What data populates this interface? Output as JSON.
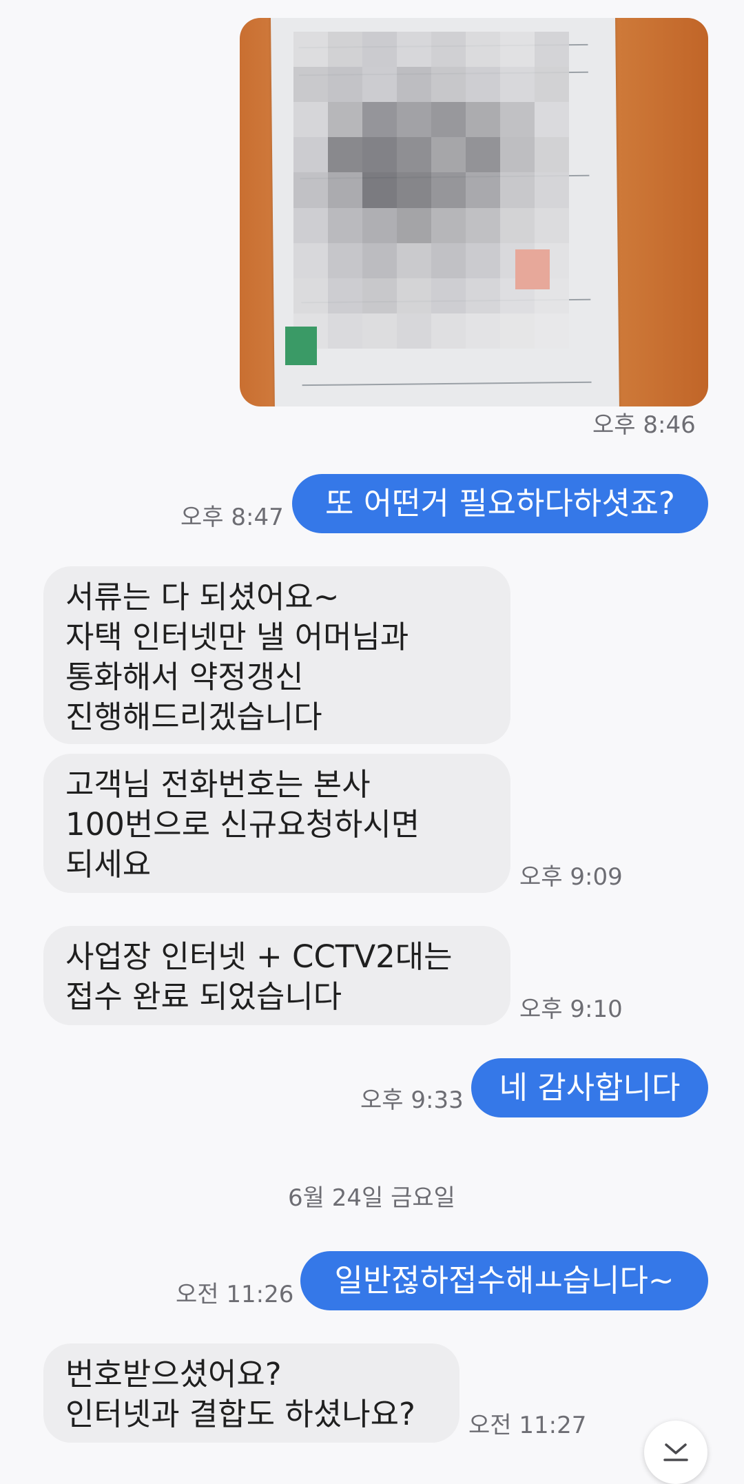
{
  "messages": {
    "photo": {
      "time": "오후 8:46"
    },
    "m1": {
      "text": "또 어떤거 필요하다하셧죠?",
      "time": "오후 8:47"
    },
    "m2": {
      "text": "서류는 다 되셨어요~\n자택 인터넷만  낼 어머님과\n통화해서 약정갱신\n진행해드리겠습니다"
    },
    "m3": {
      "text": "고객님 전화번호는 본사\n100번으로 신규요청하시면\n되세요",
      "time": "오후 9:09"
    },
    "m4": {
      "text": "사업장 인터넷 + CCTV2대는\n접수 완료 되었습니다",
      "time": "오후 9:10"
    },
    "m5": {
      "text": "네 감사합니다",
      "time": "오후 9:33"
    },
    "date_separator": "6월 24일 금요일",
    "m6": {
      "text": "일반젆하접수해ㅛ습니다~",
      "time": "오전 11:26"
    },
    "m7": {
      "text": "번호받으셨어요?\n인터넷과 결합도 하셨나요?",
      "time": "오전 11:27"
    }
  },
  "icons": {
    "scroll_down": "chevron-down-to-bottom-icon"
  },
  "colors": {
    "outgoing_bubble": "#3578e8",
    "incoming_bubble": "#ededef",
    "background": "#f8f8fa",
    "timestamp": "#6d6d73"
  }
}
